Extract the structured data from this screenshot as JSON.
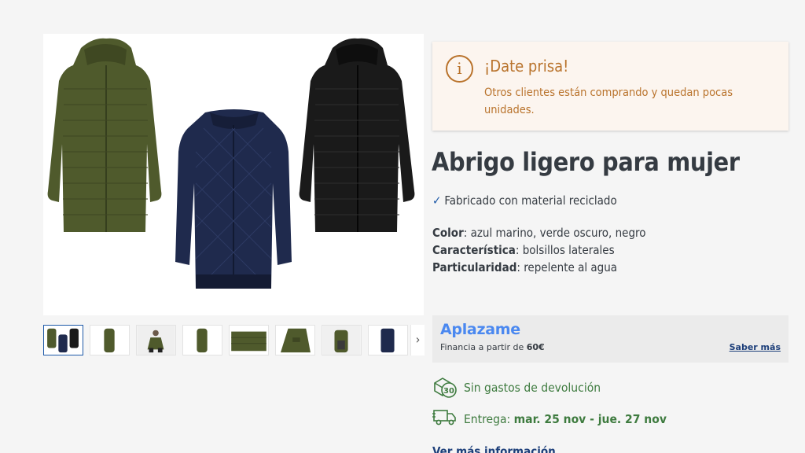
{
  "alert": {
    "title": "¡Date prisa!",
    "text": "Otros clientes están comprando y quedan pocas unidades."
  },
  "product": {
    "title": "Abrigo ligero para mujer",
    "feature": "Fabricado con material reciclado",
    "attributes": [
      {
        "label": "Color",
        "value": ": azul marino, verde oscuro, negro"
      },
      {
        "label": "Característica",
        "value": ": bolsillos laterales"
      },
      {
        "label": "Particularidad",
        "value": ": repelente al agua"
      }
    ]
  },
  "finance": {
    "brand": "Aplazame",
    "text_prefix": "Financia a partir de ",
    "amount": "60€",
    "link": "Saber más"
  },
  "shipping": {
    "returns": "Sin gastos de devolución",
    "returns_badge": "30",
    "delivery_label": "Entrega: ",
    "delivery_dates": "mar. 25 nov - jue. 27 nov"
  },
  "more_info": "Ver más información",
  "gallery": {
    "thumbnails": 8,
    "active_index": 0,
    "next_arrow": "›"
  },
  "colors": {
    "olive": "#4f5a2c",
    "navy": "#1f2a4d",
    "black": "#1a1a1a",
    "alert": "#b9732c",
    "link": "#1d59a8",
    "green": "#3e7b3f"
  }
}
